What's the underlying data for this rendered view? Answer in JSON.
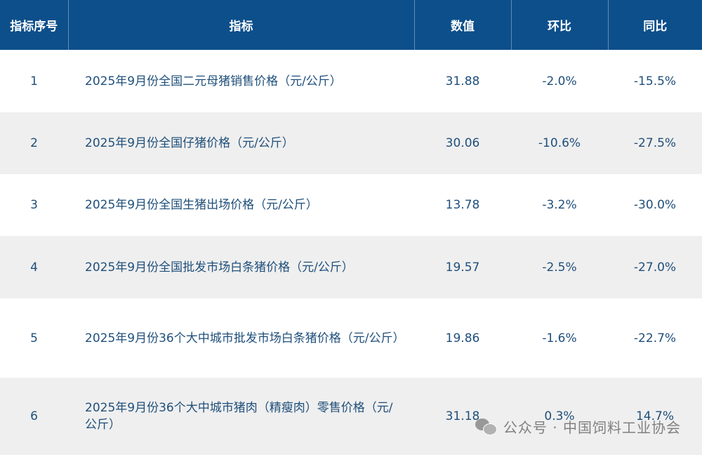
{
  "table": {
    "headers": [
      "指标序号",
      "指标",
      "数值",
      "环比",
      "同比"
    ],
    "rows": [
      {
        "index": "1",
        "name": "2025年9月份全国二元母猪销售价格（元/公斤）",
        "value": "31.88",
        "mom": "-2.0%",
        "yoy": "-15.5%"
      },
      {
        "index": "2",
        "name": "2025年9月份全国仔猪价格（元/公斤）",
        "value": "30.06",
        "mom": "-10.6%",
        "yoy": "-27.5%"
      },
      {
        "index": "3",
        "name": "2025年9月份全国生猪出场价格（元/公斤）",
        "value": "13.78",
        "mom": "-3.2%",
        "yoy": "-30.0%"
      },
      {
        "index": "4",
        "name": "2025年9月份全国批发市场白条猪价格（元/公斤）",
        "value": "19.57",
        "mom": "-2.5%",
        "yoy": "-27.0%"
      },
      {
        "index": "5",
        "name": "2025年9月份36个大中城市批发市场白条猪价格（元/公斤）",
        "value": "19.86",
        "mom": "-1.6%",
        "yoy": "-22.7%"
      },
      {
        "index": "6",
        "name": "2025年9月份36个大中城市猪肉（精瘦肉）零售价格（元/公斤）",
        "value": "31.18",
        "mom": "0.3%",
        "yoy": "14.7%"
      }
    ]
  },
  "watermark": {
    "text": "公众号 · 中国饲料工业协会",
    "icon": "wechat-icon"
  },
  "colors": {
    "header_bg": "#0d4f8b",
    "header_text": "#ffffff",
    "cell_text": "#1f4f7a",
    "row_alt_bg": "#efefef"
  }
}
